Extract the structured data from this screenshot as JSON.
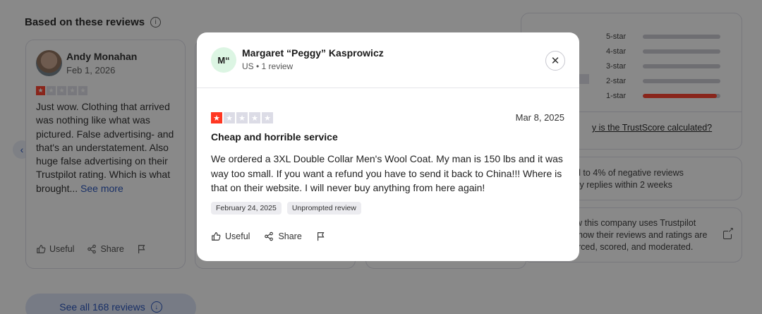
{
  "section": {
    "title": "Based on these reviews",
    "info_icon": "info-icon"
  },
  "review_card": {
    "name": "Andy Monahan",
    "date": "Feb 1, 2026",
    "rating": 1,
    "text": "Just wow. Clothing that arrived was nothing like what was pictured. False advertising- and that's an understatement. Also huge false advertising on their Trustpilot rating. Which is what brought...",
    "see_more": "See more",
    "useful_label": "Useful",
    "share_label": "Share"
  },
  "rating_breakdown": {
    "rows": [
      {
        "label": "5-star",
        "fraction": 0.0
      },
      {
        "label": "4-star",
        "fraction": 0.0
      },
      {
        "label": "3-star",
        "fraction": 0.0
      },
      {
        "label": "2-star",
        "fraction": 0.0
      },
      {
        "label": "1-star",
        "fraction": 0.95
      }
    ],
    "link_text": "y is the TrustScore calculated?"
  },
  "info_cards": {
    "reply_line1": "d to 4% of negative reviews",
    "reply_line2": "lly replies within 2 weeks",
    "trust_line1": "w this company uses Trustpilot",
    "trust_line2": "how their reviews and ratings are",
    "trust_line3": "rced, scored, and moderated."
  },
  "see_all": {
    "label": "See all 168 reviews"
  },
  "modal": {
    "avatar_initials": "M“",
    "name": "Margaret “Peggy” Kasprowicz",
    "meta": "US • 1 review",
    "rating": 1,
    "date": "Mar 8, 2025",
    "title": "Cheap and horrible service",
    "body": "We ordered a 3XL Double Collar Men's Wool Coat. My man is 150 lbs and it was way too small. If you want a refund you have to send it back to China!!! Where is that on their website. I will never buy anything from here again!",
    "chips": [
      "February 24, 2025",
      "Unprompted review"
    ],
    "useful_label": "Useful",
    "share_label": "Share"
  },
  "colors": {
    "star_on": "#ff3722",
    "star_off": "#dcdce6",
    "link_blue": "#1c4bb8",
    "overlay": "rgba(20,20,20,0.5)"
  }
}
